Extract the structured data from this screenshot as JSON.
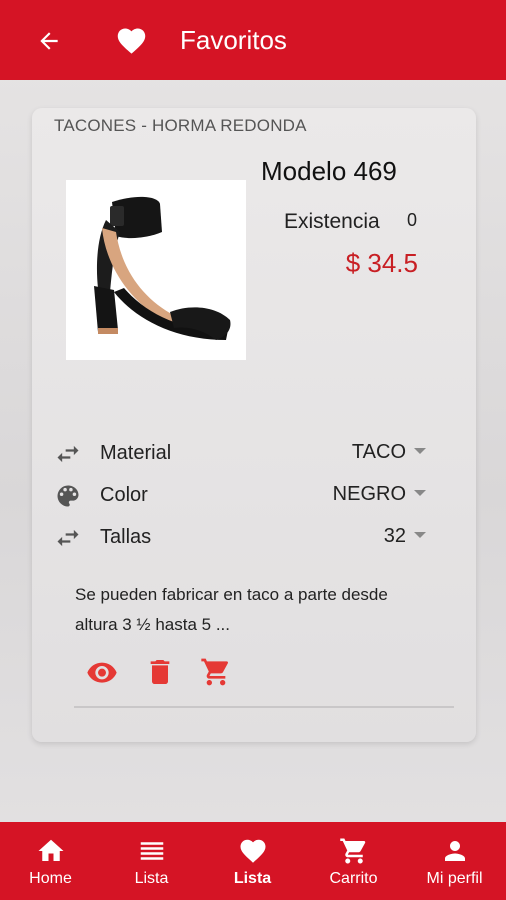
{
  "header": {
    "title": "Favoritos",
    "back_icon": "arrow-left-icon",
    "title_icon": "heart-icon"
  },
  "product": {
    "category": "TACONES - HORMA REDONDA",
    "model": "Modelo 469",
    "stock_label": "Existencia",
    "stock_value": "0",
    "price": "$ 34.5",
    "options": [
      {
        "label": "Material",
        "value": "TACO",
        "icon": "swap-arrows-icon"
      },
      {
        "label": "Color",
        "value": "NEGRO",
        "icon": "palette-icon"
      },
      {
        "label": "Tallas",
        "value": "32",
        "icon": "swap-arrows-icon"
      }
    ],
    "description": "Se pueden fabricar en taco a parte desde altura 3 ½ hasta 5 ...",
    "actions": [
      "eye-icon",
      "trash-icon",
      "cart-icon"
    ]
  },
  "bottom_nav": [
    {
      "label": "Home",
      "icon": "home-icon"
    },
    {
      "label": "Lista",
      "icon": "list-icon"
    },
    {
      "label": "Lista",
      "icon": "heart-icon",
      "active": true
    },
    {
      "label": "Carrito",
      "icon": "cart-icon"
    },
    {
      "label": "Mi perfil",
      "icon": "person-icon"
    }
  ],
  "colors": {
    "primary": "#d51425",
    "price": "#c81f24",
    "action": "#e53935"
  }
}
